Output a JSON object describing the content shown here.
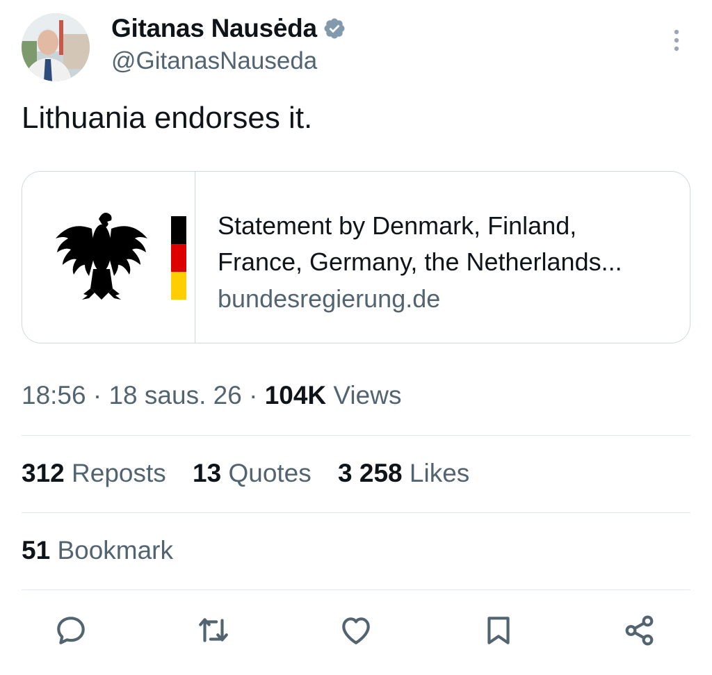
{
  "author": {
    "name": "Gitanas Nausėda",
    "handle": "@GitanasNauseda",
    "verified": true
  },
  "tweet": {
    "text": "Lithuania endorses it."
  },
  "link_card": {
    "title_line1": "Statement by Denmark, Finland,",
    "title_line2": "France, Germany, the Netherlands...",
    "domain": "bundesregierung.de",
    "thumbnail": "german-federal-eagle-logo"
  },
  "meta": {
    "time": "18:56",
    "separator": "·",
    "date": "18 saus. 26",
    "views_count": "104K",
    "views_label": "Views"
  },
  "stats": {
    "reposts_count": "312",
    "reposts_label": "Reposts",
    "quotes_count": "13",
    "quotes_label": "Quotes",
    "likes_count": "3 258",
    "likes_label": "Likes",
    "bookmarks_count": "51",
    "bookmarks_label": "Bookmark"
  },
  "actions": [
    "reply-icon",
    "repost-icon",
    "like-icon",
    "bookmark-icon",
    "share-icon"
  ],
  "colors": {
    "text": "#0f1419",
    "secondary": "#536471",
    "border": "#cfd9de",
    "divider": "#e1e8ed",
    "verified": "#829aab",
    "flag_black": "#000000",
    "flag_red": "#dd0000",
    "flag_gold": "#ffce00"
  }
}
